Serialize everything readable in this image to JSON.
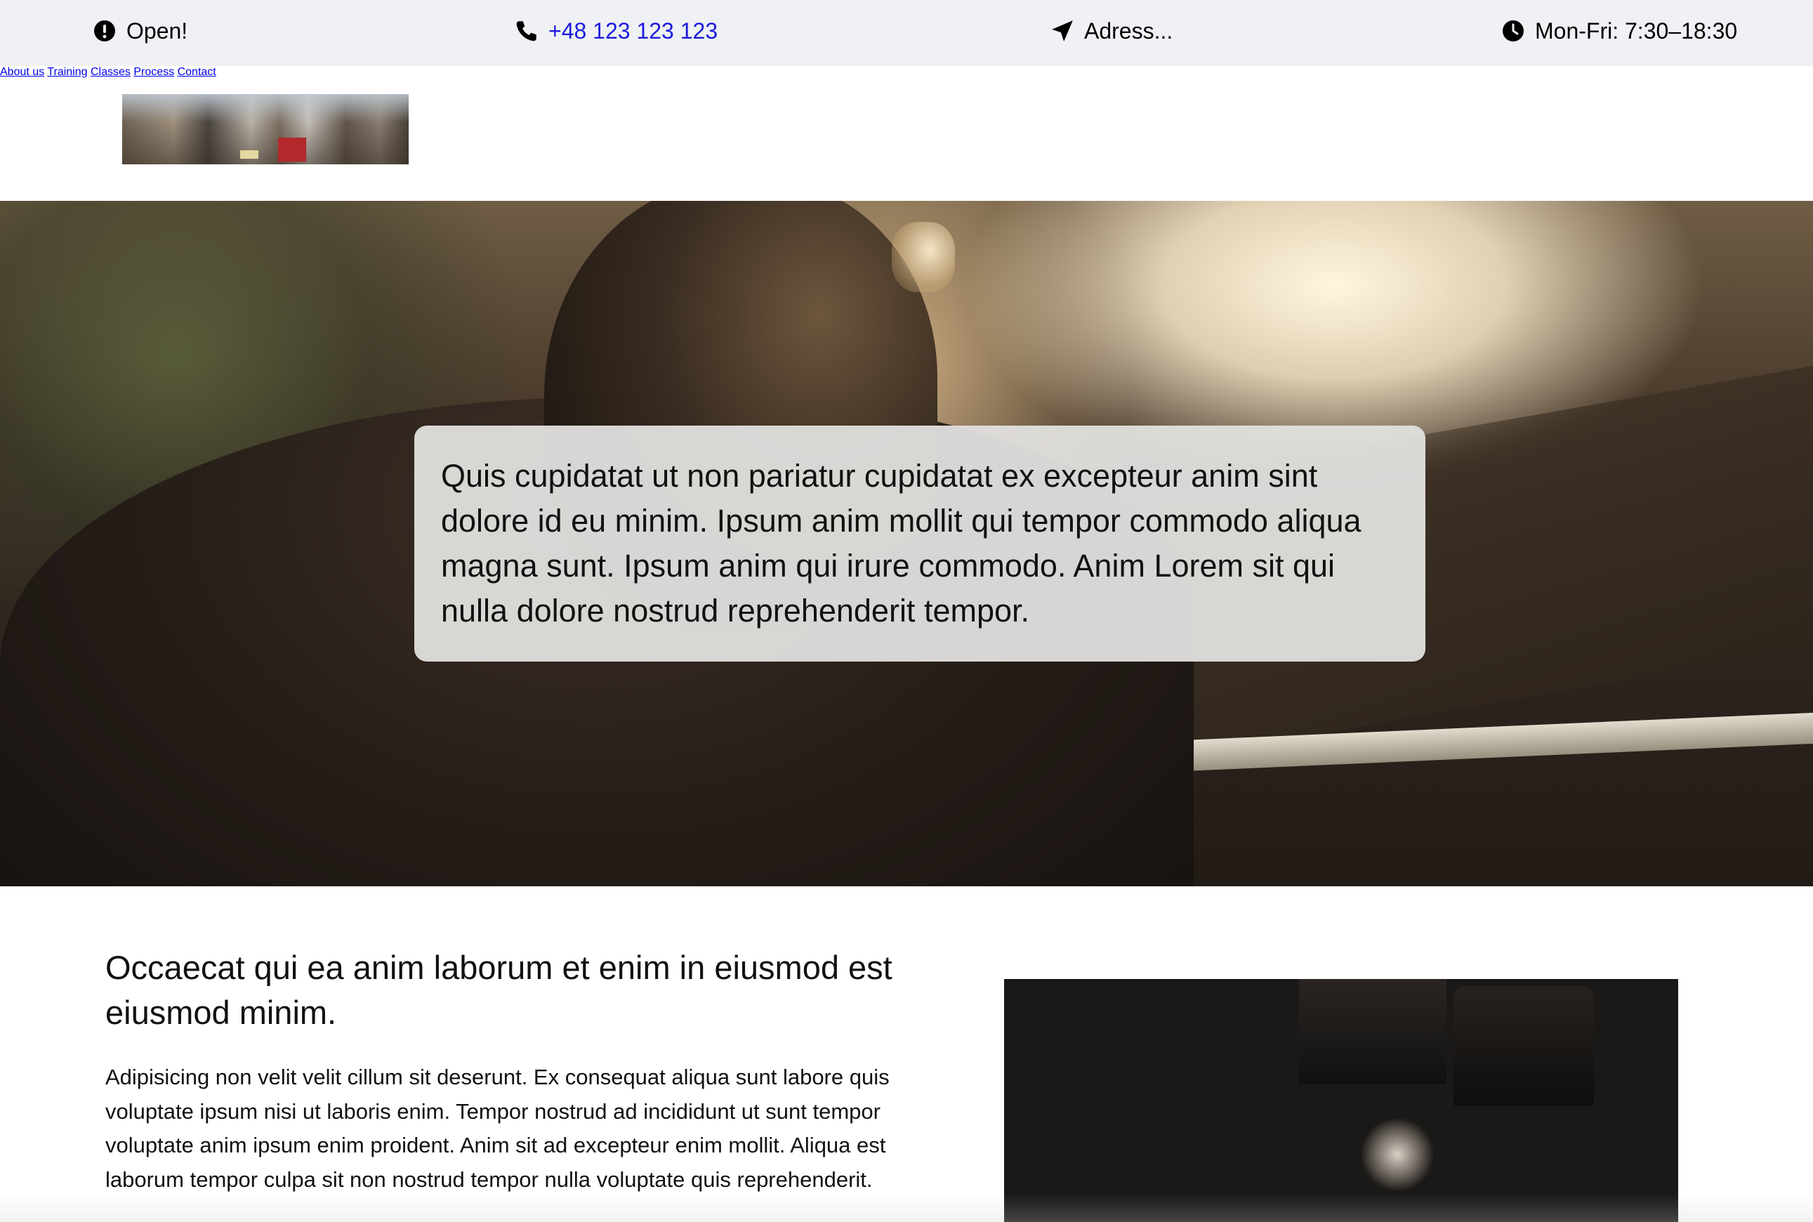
{
  "topbar": {
    "status_text": "Open!",
    "status_icon": "exclamation-circle-icon",
    "phone_text": "+48 123 123 123",
    "phone_icon": "phone-icon",
    "address_text": "Adress...",
    "address_icon": "location-arrow-icon",
    "hours_text": "Mon-Fri: 7:30–18:30",
    "hours_icon": "clock-icon",
    "phone_link_color": "#1a1adb",
    "background_color": "#eff1f5"
  },
  "header": {
    "logo_alt": "city street logo image",
    "nav": [
      {
        "label": "About us"
      },
      {
        "label": "Training"
      },
      {
        "label": "Classes"
      },
      {
        "label": "Process"
      },
      {
        "label": "Contact"
      }
    ]
  },
  "hero": {
    "image": "man in leather jacket and sunglasses at sunset",
    "card_text": "Quis cupidatat ut non pariatur cupidatat ex excepteur anim sint dolore id eu minim. Ipsum anim mollit qui tempor commodo aliqua magna sunt. Ipsum anim qui irure commodo. Anim Lorem sit qui nulla dolore nostrud reprehenderit tempor."
  },
  "section": {
    "title": "Occaecat qui ea anim laborum et enim in eiusmod est eiusmod minim.",
    "body": "Adipisicing non velit velit cillum sit deserunt. Ex consequat aliqua sunt labore quis voluptate ipsum nisi ut laboris enim. Tempor nostrud ad incididunt ut sunt tempor voluptate anim ipsum enim proident. Anim sit ad excepteur enim mollit. Aliqua est laborum tempor culpa sit non nostrud tempor nulla voluptate quis reprehenderit.",
    "image": "vintage cameras"
  }
}
